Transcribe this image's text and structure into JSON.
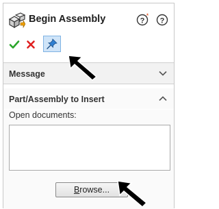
{
  "header": {
    "title": "Begin Assembly",
    "icons": [
      "assembly-icon",
      "help-icon",
      "help-icon"
    ]
  },
  "toolbar": {
    "ok": "check-icon",
    "cancel": "close-icon",
    "pin": "pushpin-icon"
  },
  "sections": [
    {
      "label": "Message",
      "state": "collapsed"
    },
    {
      "label": "Part/Assembly to Insert",
      "state": "expanded"
    }
  ],
  "insert": {
    "open_docs_label": "Open documents:",
    "documents": [],
    "browse_label_prefix": "",
    "browse_label_mnemonic": "B",
    "browse_label_rest": "rowse..."
  },
  "colors": {
    "ok_green": "#2aa52a",
    "cancel_red": "#e02020",
    "pin_blue": "#2f7fd1",
    "annotation_arrow": "#000000"
  }
}
